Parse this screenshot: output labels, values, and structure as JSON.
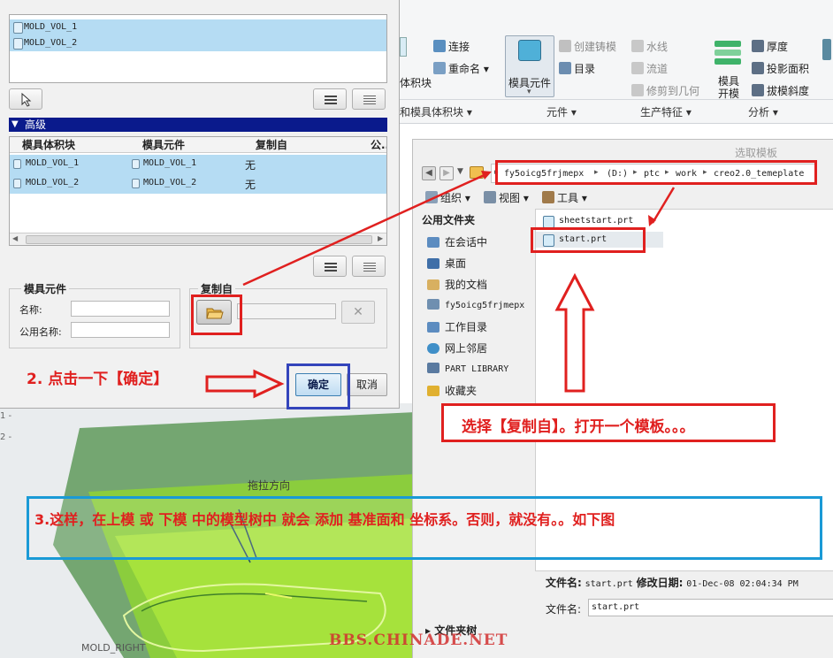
{
  "top_list": {
    "items": [
      "MOLD_VOL_1",
      "MOLD_VOL_2"
    ]
  },
  "advanced": {
    "header": "高级",
    "columns": [
      "模具体积块",
      "模具元件",
      "复制自",
      "公..."
    ],
    "rows": [
      {
        "volume": "MOLD_VOL_1",
        "component": "MOLD_VOL_1",
        "copy_from": "无"
      },
      {
        "volume": "MOLD_VOL_2",
        "component": "MOLD_VOL_2",
        "copy_from": "无"
      }
    ]
  },
  "component_group": {
    "title": "模具元件",
    "name_label": "名称:",
    "common_name_label": "公用名称:"
  },
  "copy_from_group": {
    "title": "复制自"
  },
  "buttons": {
    "ok": "确定",
    "cancel": "取消"
  },
  "ribbon": {
    "connect": "连接",
    "rename": "重命名",
    "volume_partial": "体积块",
    "mold_component": "模具元件",
    "create_casting": "创建铸模",
    "catalog": "目录",
    "waterline": "水线",
    "runner": "流道",
    "trim_geometry": "修剪到几何",
    "mold_open_top": "模具",
    "mold_open_bottom": "开模",
    "thickness": "厚度",
    "projected_area": "投影面积",
    "draft": "拔模斜度",
    "groups": {
      "volume": "和模具体积块",
      "component": "元件",
      "production": "生产特征",
      "analysis": "分析"
    }
  },
  "open_dialog": {
    "title": "选取模板",
    "path": [
      "fy5oicg5frjmepx",
      "(D:)",
      "ptc",
      "work",
      "creo2.0_temeplate"
    ],
    "toolbar": {
      "organize": "组织",
      "view": "视图",
      "tools": "工具"
    },
    "common_folders": "公用文件夹",
    "sidebar": [
      "在会话中",
      "桌面",
      "我的文档",
      "fy5oicg5frjmepx",
      "工作目录",
      "网上邻居",
      "PART LIBRARY",
      "收藏夹"
    ],
    "files": [
      "sheetstart.prt",
      "start.prt"
    ],
    "info": {
      "filename_label": "文件名:",
      "filename": "start.prt",
      "modified_label": "修改日期:",
      "modified": "01-Dec-08 02:04:34 PM"
    },
    "filename_field_label": "文件名:",
    "filename_value": "start.prt",
    "folder_tree": "文件夹树"
  },
  "annotations": {
    "step2": "2. 点击一下【确定】",
    "select_copy": "选择【复制自】。打开一个模板。。。",
    "step3": "3.这样，在上模 或 下模 中的模型树中 就会 添加 基准面和 坐标系。否则，就没有。。如下图"
  },
  "viewport": {
    "pull_direction": "拖拉方向",
    "mold_right": "MOLD_RIGHT",
    "tick1": "1 -",
    "tick2": "2 -"
  },
  "watermark": "BBS.CHINADE.NET",
  "colors": {
    "accent_red": "#e0201f",
    "accent_blue": "#1a9ad6",
    "ok_box": "#3344bb",
    "selection": "#b5dcf3"
  }
}
